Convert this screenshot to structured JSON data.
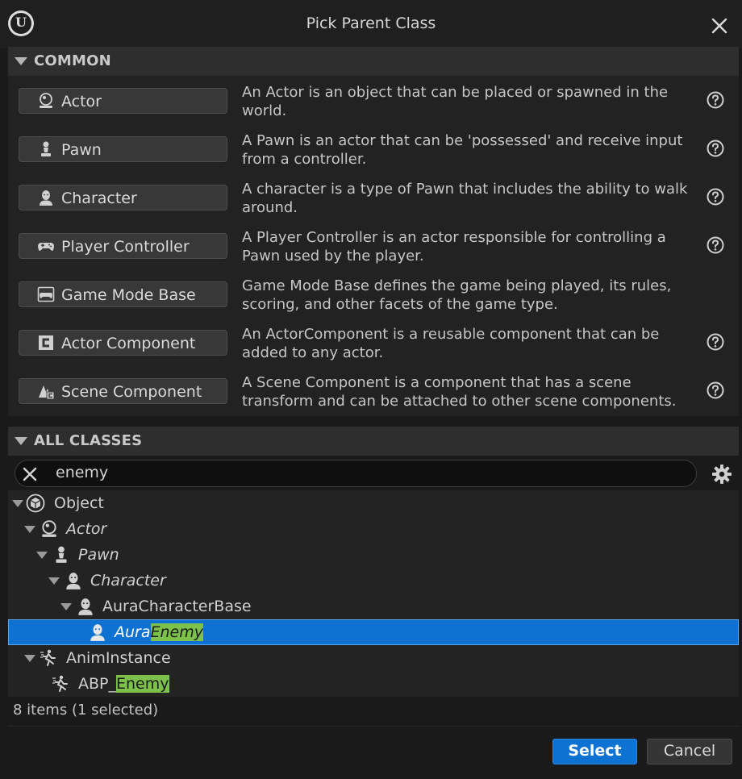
{
  "window": {
    "title": "Pick Parent Class"
  },
  "common": {
    "header": "COMMON",
    "items": [
      {
        "label": "Actor",
        "icon": "actor-icon",
        "description": "An Actor is an object that can be placed or spawned in the world.",
        "help": true
      },
      {
        "label": "Pawn",
        "icon": "pawn-icon",
        "description": "A Pawn is an actor that can be 'possessed' and receive input from a controller.",
        "help": true
      },
      {
        "label": "Character",
        "icon": "character-icon",
        "description": "A character is a type of Pawn that includes the ability to walk around.",
        "help": true
      },
      {
        "label": "Player Controller",
        "icon": "gamepad-icon",
        "description": "A Player Controller is an actor responsible for controlling a Pawn used by the player.",
        "help": true
      },
      {
        "label": "Game Mode Base",
        "icon": "game-mode-icon",
        "description": "Game Mode Base defines the game being played, its rules, scoring, and other facets of the game type.",
        "help": false
      },
      {
        "label": "Actor Component",
        "icon": "actor-component-icon",
        "description": "An ActorComponent is a reusable component that can be added to any actor.",
        "help": true
      },
      {
        "label": "Scene Component",
        "icon": "scene-component-icon",
        "description": "A Scene Component is a component that has a scene transform and can be attached to other scene components.",
        "help": true
      }
    ]
  },
  "all_classes": {
    "header": "ALL CLASSES",
    "search_value": "enemy",
    "tree": [
      {
        "label": "Object",
        "italic": false,
        "expanded": true,
        "icon": "object-icon"
      },
      {
        "label": "Actor",
        "italic": true,
        "expanded": true,
        "icon": "actor-icon"
      },
      {
        "label": "Pawn",
        "italic": true,
        "expanded": true,
        "icon": "pawn-icon"
      },
      {
        "label": "Character",
        "italic": true,
        "expanded": true,
        "icon": "character-icon"
      },
      {
        "label": "AuraCharacterBase",
        "italic": false,
        "expanded": true,
        "icon": "character-icon"
      },
      {
        "label_prefix": "Aura",
        "label_match": "Enemy",
        "italic": true,
        "selected": true,
        "icon": "character-icon"
      },
      {
        "label": "AnimInstance",
        "italic": false,
        "expanded": true,
        "icon": "anim-instance-icon"
      },
      {
        "label_prefix": "ABP_",
        "label_match": "Enemy",
        "italic": false,
        "icon": "anim-instance-icon"
      }
    ],
    "status": "8 items (1 selected)"
  },
  "footer": {
    "select_label": "Select",
    "cancel_label": "Cancel"
  },
  "colors": {
    "accent": "#0e72d3",
    "highlight": "#7cc24a",
    "background": "#1a1a1a"
  }
}
